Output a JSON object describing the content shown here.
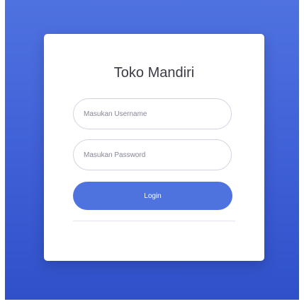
{
  "login": {
    "title": "Toko Mandiri",
    "username_placeholder": "Masukan Username",
    "password_placeholder": "Masukan Password",
    "login_label": "Login"
  },
  "colors": {
    "background": "#4e73df",
    "primary_button": "#4e73df",
    "card": "#ffffff"
  }
}
